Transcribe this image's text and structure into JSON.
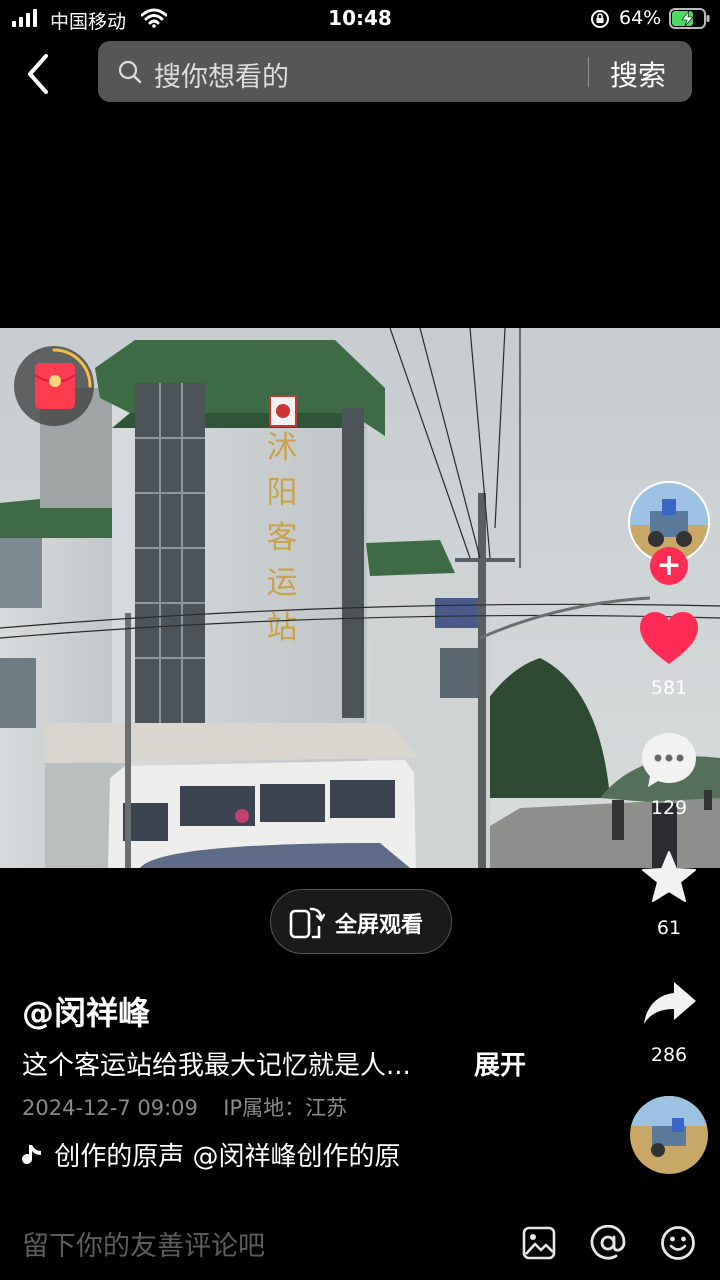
{
  "status_bar": {
    "carrier": "中国移动",
    "time": "10:48",
    "battery_percent": "64%",
    "icons": [
      "signal-icon",
      "wifi-icon",
      "rotation-lock-icon",
      "battery-charging-icon"
    ]
  },
  "search": {
    "placeholder": "搜你想看的",
    "button_label": "搜索"
  },
  "overlay": {
    "fullscreen_label": "全屏观看"
  },
  "right_rail": {
    "likes": "581",
    "comments": "129",
    "favorites": "61",
    "shares": "286",
    "follow_symbol": "+"
  },
  "post": {
    "author": "@闵祥峰",
    "description": "这个客运站给我最大记忆就是人...",
    "expand_label": "展开",
    "date": "2024-12-7 09:09",
    "ip_location": "IP属地：江苏",
    "music_text": "创作的原声    @闵祥峰创作的原"
  },
  "comment_bar": {
    "placeholder": "留下你的友善评论吧"
  },
  "video_scene": {
    "sign_text": "沭阳客运站"
  },
  "colors": {
    "accent": "#fe2c55",
    "background": "#000000",
    "battery_fill": "#4cd964"
  }
}
